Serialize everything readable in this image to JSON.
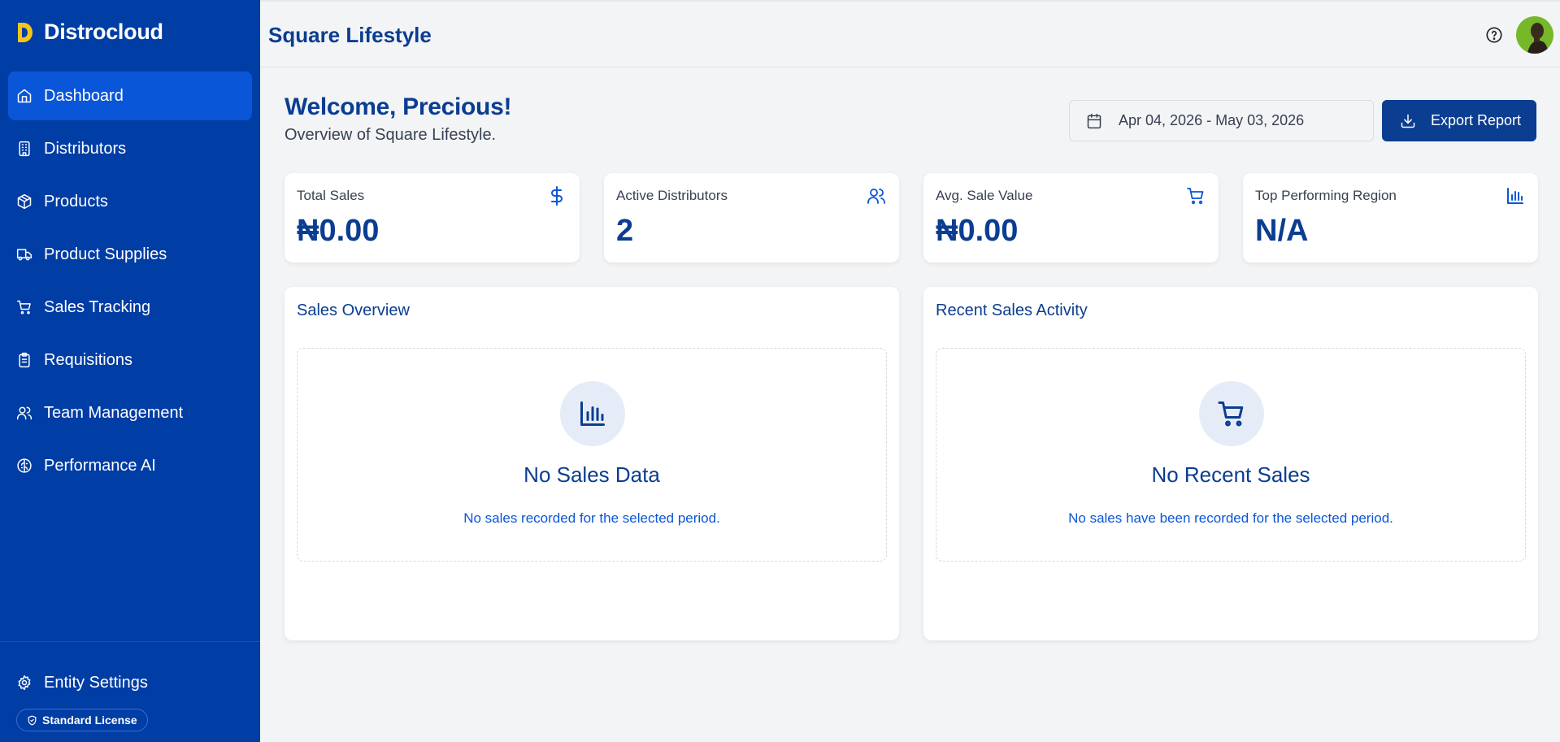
{
  "brand": {
    "name": "Distrocloud"
  },
  "sidebar": {
    "items": [
      {
        "label": "Dashboard",
        "icon": "home-icon",
        "active": true
      },
      {
        "label": "Distributors",
        "icon": "building-icon"
      },
      {
        "label": "Products",
        "icon": "package-icon"
      },
      {
        "label": "Product Supplies",
        "icon": "truck-icon"
      },
      {
        "label": "Sales Tracking",
        "icon": "cart-icon"
      },
      {
        "label": "Requisitions",
        "icon": "clipboard-icon"
      },
      {
        "label": "Team Management",
        "icon": "users-icon"
      },
      {
        "label": "Performance AI",
        "icon": "brain-icon"
      }
    ],
    "settings_label": "Entity Settings",
    "license_label": "Standard License"
  },
  "topbar": {
    "title": "Square Lifestyle"
  },
  "greeting": {
    "title": "Welcome, Precious!",
    "subtitle": "Overview of Square Lifestyle."
  },
  "date_range": "Apr 04, 2026 - May 03, 2026",
  "export_label": "Export Report",
  "stats": [
    {
      "label": "Total Sales",
      "value": "₦0.00",
      "icon": "dollar-icon"
    },
    {
      "label": "Active Distributors",
      "value": "2",
      "icon": "users-icon"
    },
    {
      "label": "Avg. Sale Value",
      "value": "₦0.00",
      "icon": "cart-icon"
    },
    {
      "label": "Top Performing Region",
      "value": "N/A",
      "icon": "bar-chart-icon"
    }
  ],
  "panels": [
    {
      "title": "Sales Overview",
      "empty_title": "No Sales Data",
      "empty_text": "No sales recorded for the selected period.",
      "icon": "bar-chart-icon"
    },
    {
      "title": "Recent Sales Activity",
      "empty_title": "No Recent Sales",
      "empty_text": "No sales have been recorded for the selected period.",
      "icon": "cart-icon"
    }
  ],
  "colors": {
    "sidebar": "#003da5",
    "active": "#0a56d8",
    "primary": "#0b3d91",
    "logo": "#f5c518"
  }
}
